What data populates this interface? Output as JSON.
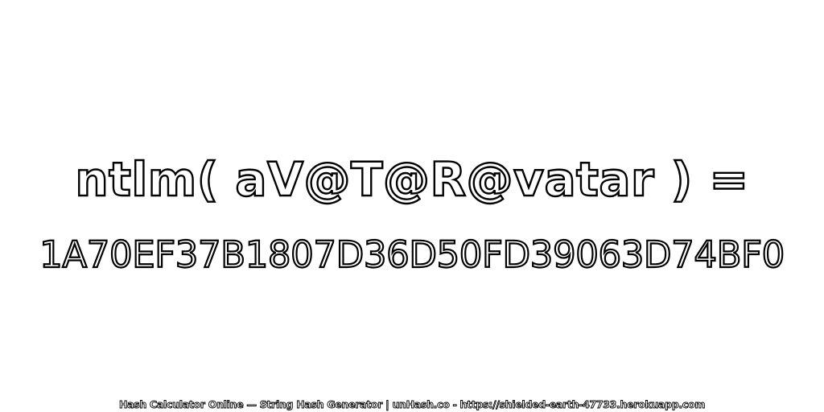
{
  "expression": "ntlm( aV@T@R@vatar ) =",
  "hash": "1A70EF37B1807D36D50FD39063D74BF0",
  "footer": "Hash Calculator Online — String Hash Generator | unHash.co - https://shielded-earth-47733.herokuapp.com",
  "colors": {
    "background": "#ffffff",
    "text_fill": "#ffffff",
    "text_outline": "#000000"
  }
}
